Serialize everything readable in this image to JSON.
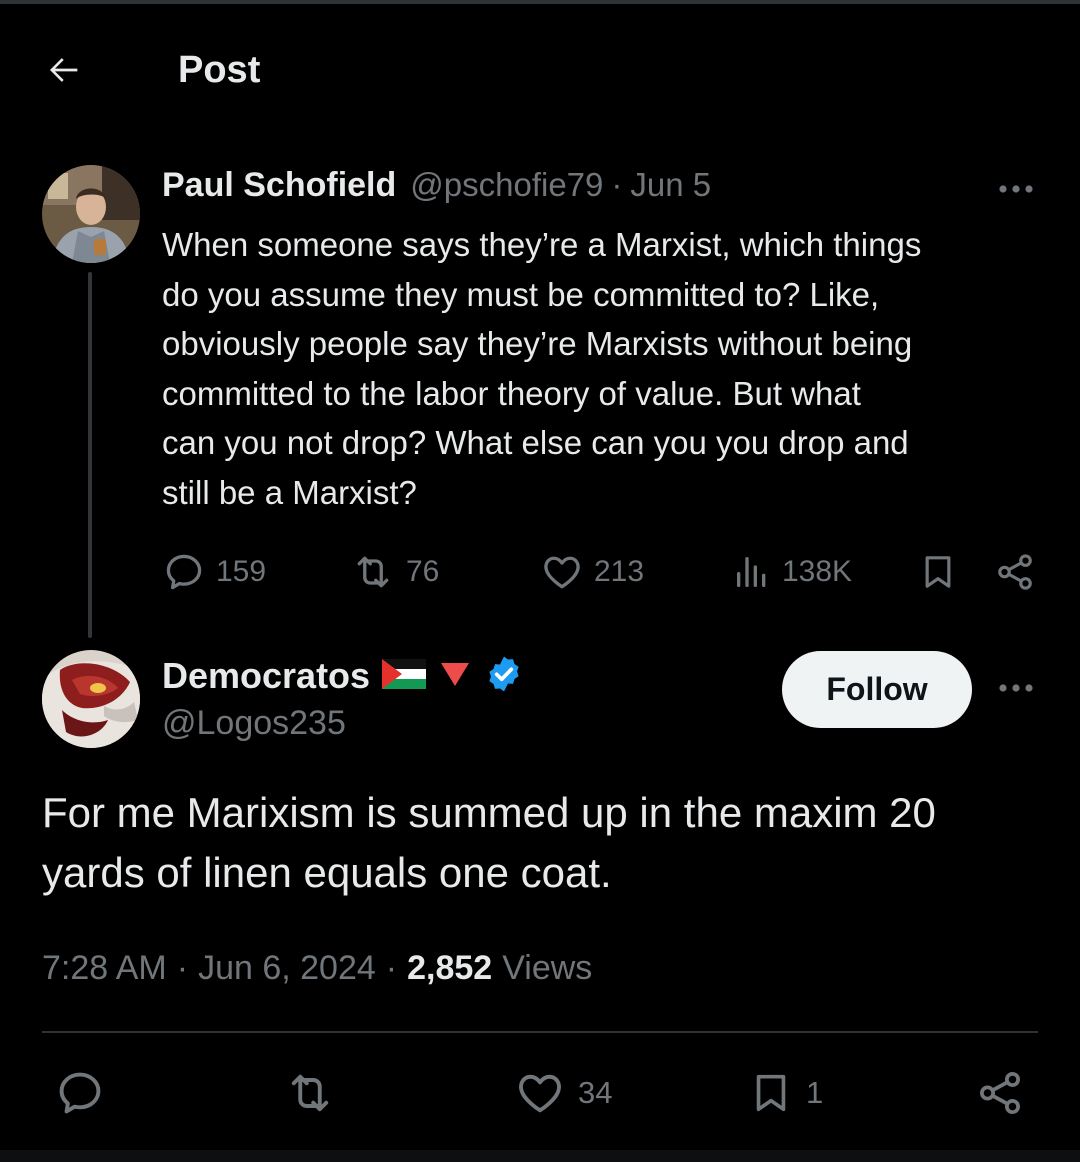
{
  "header": {
    "title": "Post"
  },
  "parent_tweet": {
    "author_name": "Paul Schofield",
    "handle": "@pschofie79",
    "separator": "·",
    "date": "Jun 5",
    "text": "When someone says they’re a Marxist, which things\ndo you assume they must be committed to? Like,\nobviously people say they’re Marxists without being\ncommitted to the labor theory of value. But what\ncan you not drop? What else can you you drop and\nstill be a Marxist?",
    "replies": "159",
    "reposts": "76",
    "likes": "213",
    "views": "138K"
  },
  "main_tweet": {
    "author_name": "Democratos",
    "handle": "@Logos235",
    "follow_label": "Follow",
    "text": "For me Marixism is summed up in the maxim 20 yards of linen equals one coat.",
    "time": "7:28 AM",
    "sep1": "·",
    "date": "Jun 6, 2024",
    "sep2": "·",
    "views_count": "2,852",
    "views_label": "Views",
    "likes": "34",
    "bookmarks": "1"
  },
  "icons": {
    "back": "arrow-left-icon",
    "more": "more-horizontal-icon",
    "reply": "speech-bubble-icon",
    "repost": "repost-icon",
    "like": "heart-icon",
    "views": "bar-chart-icon",
    "bookmark": "bookmark-icon",
    "share": "share-icon",
    "flag": "palestine-flag-icon",
    "triangle": "red-triangle-icon",
    "verified": "verified-badge-icon"
  },
  "colors": {
    "background": "#000000",
    "text_primary": "#e7e9ea",
    "text_secondary": "#71767b",
    "verified_blue": "#1d9bf0",
    "follow_bg": "#eff3f4"
  }
}
